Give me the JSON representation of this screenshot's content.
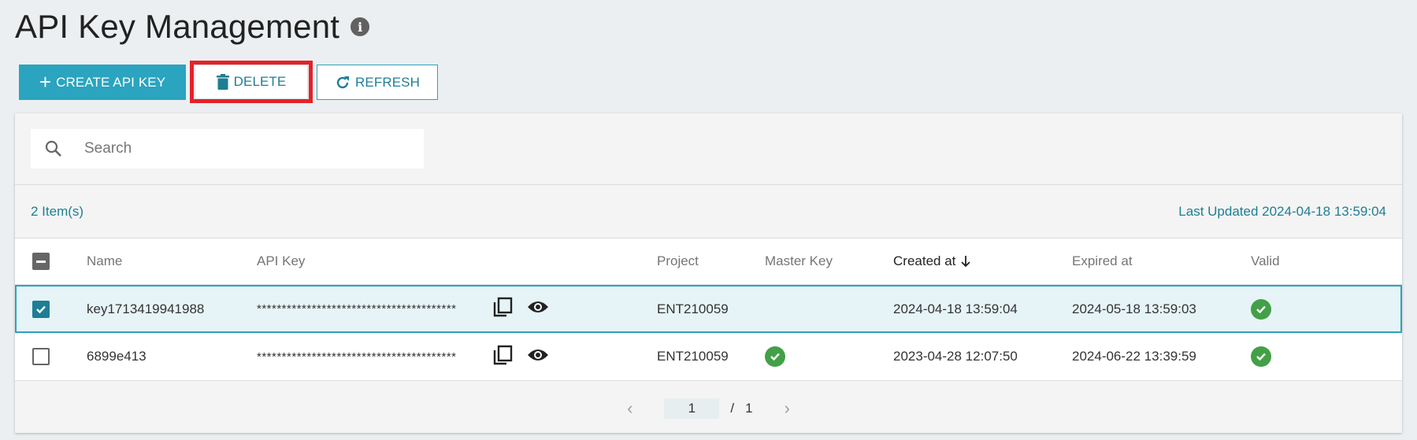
{
  "header": {
    "title": "API Key Management",
    "info_icon": "info-icon"
  },
  "toolbar": {
    "create_label": "CREATE API KEY",
    "delete_label": "DELETE",
    "refresh_label": "REFRESH"
  },
  "search": {
    "placeholder": "Search",
    "value": ""
  },
  "summary": {
    "count": "2 Item(s)",
    "last_updated": "Last Updated 2024-04-18 13:59:04"
  },
  "table": {
    "columns": {
      "name": "Name",
      "api_key": "API Key",
      "project": "Project",
      "master_key": "Master Key",
      "created_at": "Created at",
      "expired_at": "Expired at",
      "valid": "Valid"
    },
    "rows": [
      {
        "selected": true,
        "name": "key1713419941988",
        "api_key": "****************************************",
        "project": "ENT210059",
        "master_key": false,
        "created_at": "2024-04-18 13:59:04",
        "expired_at": "2024-05-18 13:59:03",
        "valid": true
      },
      {
        "selected": false,
        "name": "6899e413",
        "api_key": "****************************************",
        "project": "ENT210059",
        "master_key": true,
        "created_at": "2023-04-28 12:07:50",
        "expired_at": "2024-06-22 13:39:59",
        "valid": true
      }
    ]
  },
  "pagination": {
    "current": "1",
    "separator": "/",
    "total": "1"
  },
  "colors": {
    "accent": "#2aa4bf",
    "link": "#1e7e95",
    "highlight": "#e52229",
    "success": "#43a047"
  }
}
